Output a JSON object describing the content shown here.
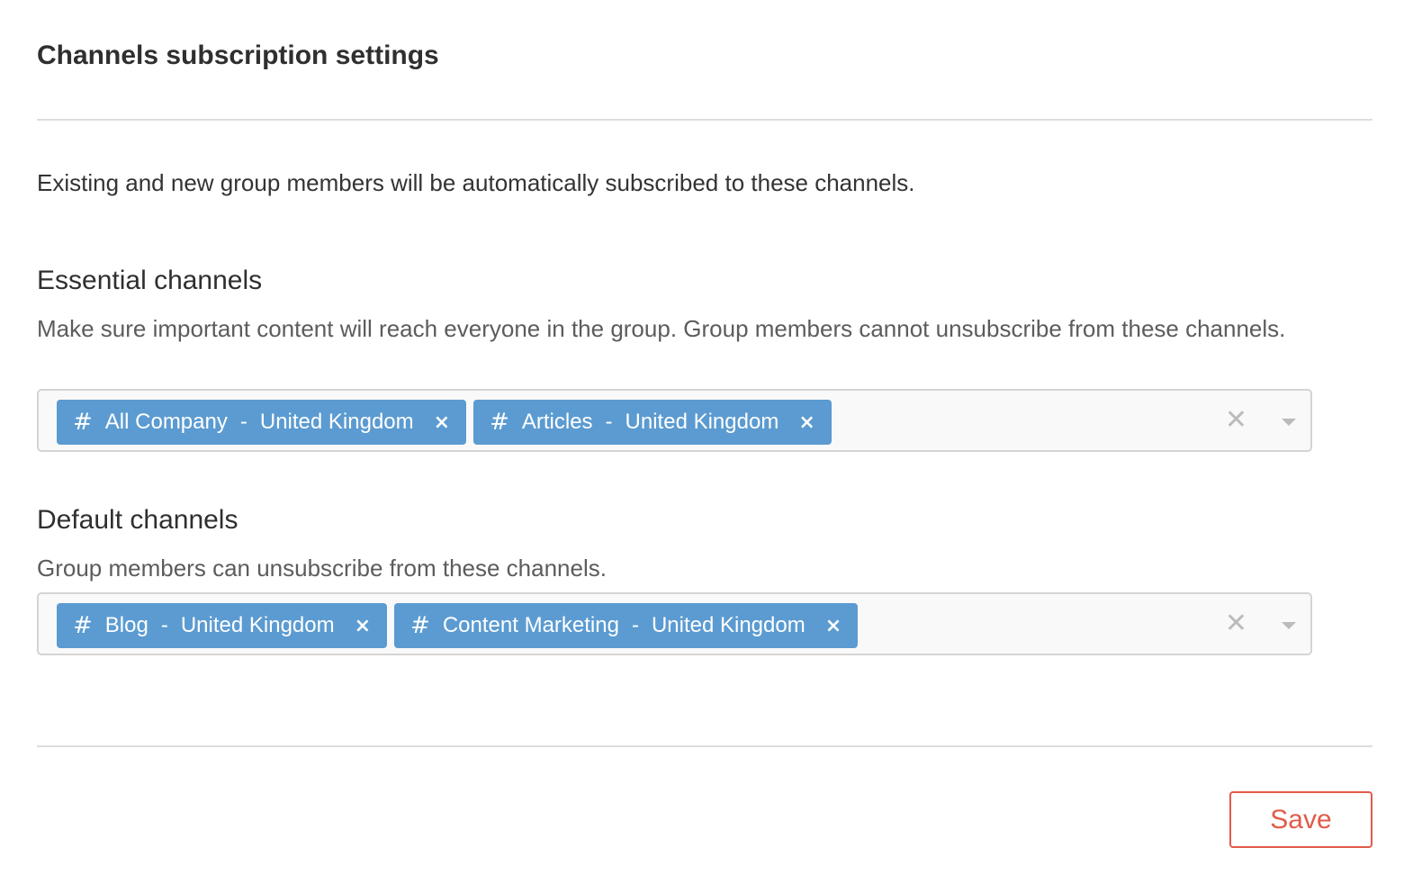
{
  "page": {
    "title": "Channels subscription settings",
    "intro": "Existing and new group members will be automatically subscribed to these channels."
  },
  "essential": {
    "heading": "Essential channels",
    "description": "Make sure important content will reach everyone in the group. Group members cannot unsubscribe from these channels.",
    "tags": [
      {
        "channel": "All Company",
        "region": "United Kingdom"
      },
      {
        "channel": "Articles",
        "region": "United Kingdom"
      }
    ]
  },
  "default": {
    "heading": "Default channels",
    "description": "Group members can unsubscribe from these channels.",
    "tags": [
      {
        "channel": "Blog",
        "region": "United Kingdom"
      },
      {
        "channel": "Content Marketing",
        "region": "United Kingdom"
      }
    ]
  },
  "common": {
    "hash_symbol": "#",
    "separator": "-",
    "remove_symbol": "×",
    "clear_symbol": "✕"
  },
  "footer": {
    "save_label": "Save"
  },
  "colors": {
    "tag_bg": "#5b9bd1",
    "save_accent": "#e15b4a"
  },
  "icons": {
    "tag_prefix": "hash-icon",
    "tag_remove": "close-icon",
    "clear": "clear-icon",
    "dropdown": "chevron-down-icon"
  }
}
